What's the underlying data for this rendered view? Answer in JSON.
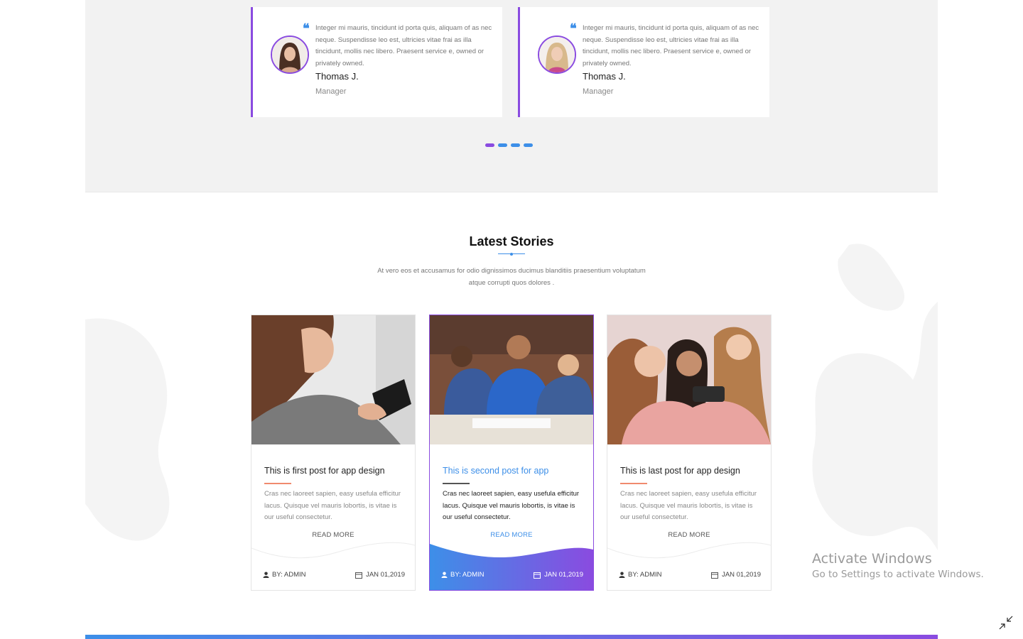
{
  "testimonials": [
    {
      "text": "Integer mi mauris, tincidunt id porta quis, aliquam of as nec neque. Suspendisse leo est, ultricies vitae frai as illa tincidunt, mollis nec libero. Praesent service e, owned or privately owned.",
      "name": "Thomas J.",
      "role": "Manager",
      "quote_icon": "quote-icon"
    },
    {
      "text": "Integer mi mauris, tincidunt id porta quis, aliquam of as nec neque. Suspendisse leo est, ultricies vitae frai as illa tincidunt, mollis nec libero. Praesent service e, owned or privately owned.",
      "name": "Thomas J.",
      "role": "Manager",
      "quote_icon": "quote-icon"
    }
  ],
  "carousel": {
    "dots": 4,
    "active_index": 0
  },
  "stories": {
    "title": "Latest Stories",
    "subtitle": "At vero eos et accusamus for odio dignissimos ducimus blanditiis praesentium voluptatum atque corrupti quos dolores .",
    "posts": [
      {
        "title": "This is first post for app design",
        "excerpt": "Cras nec laoreet sapien, easy usefula efficitur lacus. Quisque vel mauris lobortis, is vitae is our useful consectetur.",
        "read_more": "READ MORE",
        "author": "BY: ADMIN",
        "date": "JAN 01,2019"
      },
      {
        "title": "This is second post for app",
        "excerpt": "Cras nec laoreet sapien, easy usefula efficitur lacus. Quisque vel mauris lobortis, is vitae is our useful consectetur.",
        "read_more": "READ MORE",
        "author": "BY: ADMIN",
        "date": "JAN 01,2019"
      },
      {
        "title": "This is last post for app design",
        "excerpt": "Cras nec laoreet sapien, easy usefula efficitur lacus. Quisque vel mauris lobortis, is vitae is our useful consectetur.",
        "read_more": "READ MORE",
        "author": "BY: ADMIN",
        "date": "JAN 01,2019"
      }
    ]
  },
  "watermark": {
    "title": "Activate Windows",
    "subtitle": "Go to Settings to activate Windows."
  },
  "colors": {
    "accent_blue": "#3d8fe8",
    "accent_purple": "#8a4be0",
    "underline_orange": "#f08a6e"
  }
}
